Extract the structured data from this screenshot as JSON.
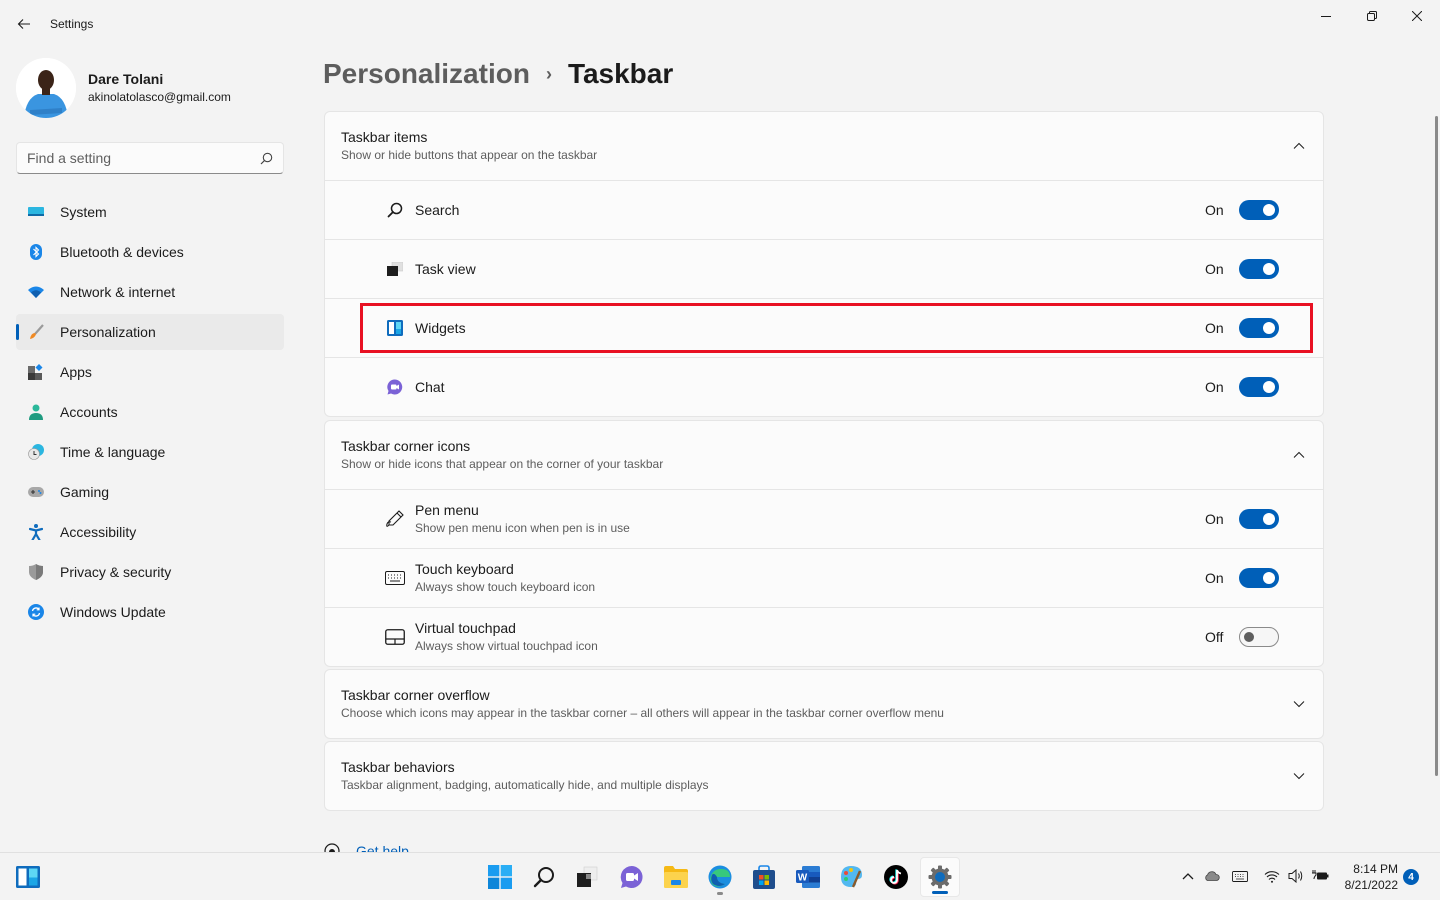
{
  "window": {
    "app_title": "Settings",
    "back_label": "Back",
    "controls": {
      "minimize": "Minimize",
      "maximize": "Maximize",
      "close": "Close"
    }
  },
  "profile": {
    "name": "Dare Tolani",
    "email": "akinolatolasco@gmail.com"
  },
  "search": {
    "placeholder": "Find a setting",
    "value": ""
  },
  "sidebar": {
    "items": [
      {
        "label": "System",
        "icon": "system-icon"
      },
      {
        "label": "Bluetooth & devices",
        "icon": "bluetooth-icon"
      },
      {
        "label": "Network & internet",
        "icon": "wifi-icon"
      },
      {
        "label": "Personalization",
        "icon": "brush-icon",
        "active": true
      },
      {
        "label": "Apps",
        "icon": "apps-icon"
      },
      {
        "label": "Accounts",
        "icon": "person-icon"
      },
      {
        "label": "Time & language",
        "icon": "clock-globe-icon"
      },
      {
        "label": "Gaming",
        "icon": "gamepad-icon"
      },
      {
        "label": "Accessibility",
        "icon": "accessibility-icon"
      },
      {
        "label": "Privacy & security",
        "icon": "shield-icon"
      },
      {
        "label": "Windows Update",
        "icon": "update-icon"
      }
    ]
  },
  "breadcrumb": {
    "parent": "Personalization",
    "separator": "›",
    "current": "Taskbar"
  },
  "groups": {
    "taskbar_items": {
      "title": "Taskbar items",
      "subtitle": "Show or hide buttons that appear on the taskbar",
      "expanded": true,
      "rows": [
        {
          "label": "Search",
          "state": "On",
          "on": true,
          "icon": "search-icon"
        },
        {
          "label": "Task view",
          "state": "On",
          "on": true,
          "icon": "task-view-icon"
        },
        {
          "label": "Widgets",
          "state": "On",
          "on": true,
          "icon": "widgets-icon",
          "highlighted": true
        },
        {
          "label": "Chat",
          "state": "On",
          "on": true,
          "icon": "chat-icon"
        }
      ]
    },
    "corner_icons": {
      "title": "Taskbar corner icons",
      "subtitle": "Show or hide icons that appear on the corner of your taskbar",
      "expanded": true,
      "rows": [
        {
          "label": "Pen menu",
          "desc": "Show pen menu icon when pen is in use",
          "state": "On",
          "on": true,
          "icon": "pen-icon"
        },
        {
          "label": "Touch keyboard",
          "desc": "Always show touch keyboard icon",
          "state": "On",
          "on": true,
          "icon": "keyboard-icon"
        },
        {
          "label": "Virtual touchpad",
          "desc": "Always show virtual touchpad icon",
          "state": "Off",
          "on": false,
          "icon": "touchpad-icon"
        }
      ]
    },
    "corner_overflow": {
      "title": "Taskbar corner overflow",
      "subtitle": "Choose which icons may appear in the taskbar corner – all others will appear in the taskbar corner overflow menu",
      "expanded": false
    },
    "behaviors": {
      "title": "Taskbar behaviors",
      "subtitle": "Taskbar alignment, badging, automatically hide, and multiple displays",
      "expanded": false
    }
  },
  "help": {
    "label": "Get help"
  },
  "taskbar": {
    "apps": [
      "Widgets",
      "Start",
      "Search",
      "Task View",
      "Chat",
      "File Explorer",
      "Microsoft Edge",
      "Microsoft Store",
      "Word",
      "Paint",
      "TikTok",
      "Settings"
    ],
    "clock": {
      "time": "8:14 PM",
      "date": "8/21/2022"
    },
    "notification_count": "4"
  },
  "colors": {
    "accent": "#005fb8",
    "highlight_box": "#e81123",
    "background": "#f3f3f3",
    "card": "#fbfbfb"
  }
}
